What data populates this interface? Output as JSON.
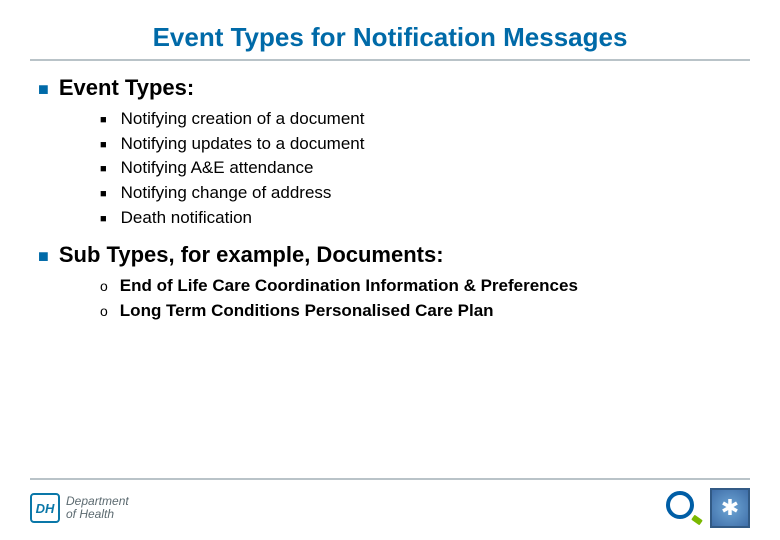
{
  "title": "Event Types for Notification Messages",
  "sections": [
    {
      "heading": "Event Types:",
      "bullet": "square",
      "bold": false,
      "items": [
        "Notifying creation of a document",
        "Notifying updates to a document",
        "Notifying A&E attendance",
        "Notifying change of address",
        "Death notification"
      ]
    },
    {
      "heading": "Sub Types, for example, Documents:",
      "bullet": "circle",
      "bold": true,
      "items": [
        "End of Life Care Coordination Information & Preferences",
        "Long Term Conditions Personalised Care Plan"
      ]
    }
  ],
  "footer": {
    "dh_abbrev": "DH",
    "dh_line1": "Department",
    "dh_line2": "of Health"
  }
}
